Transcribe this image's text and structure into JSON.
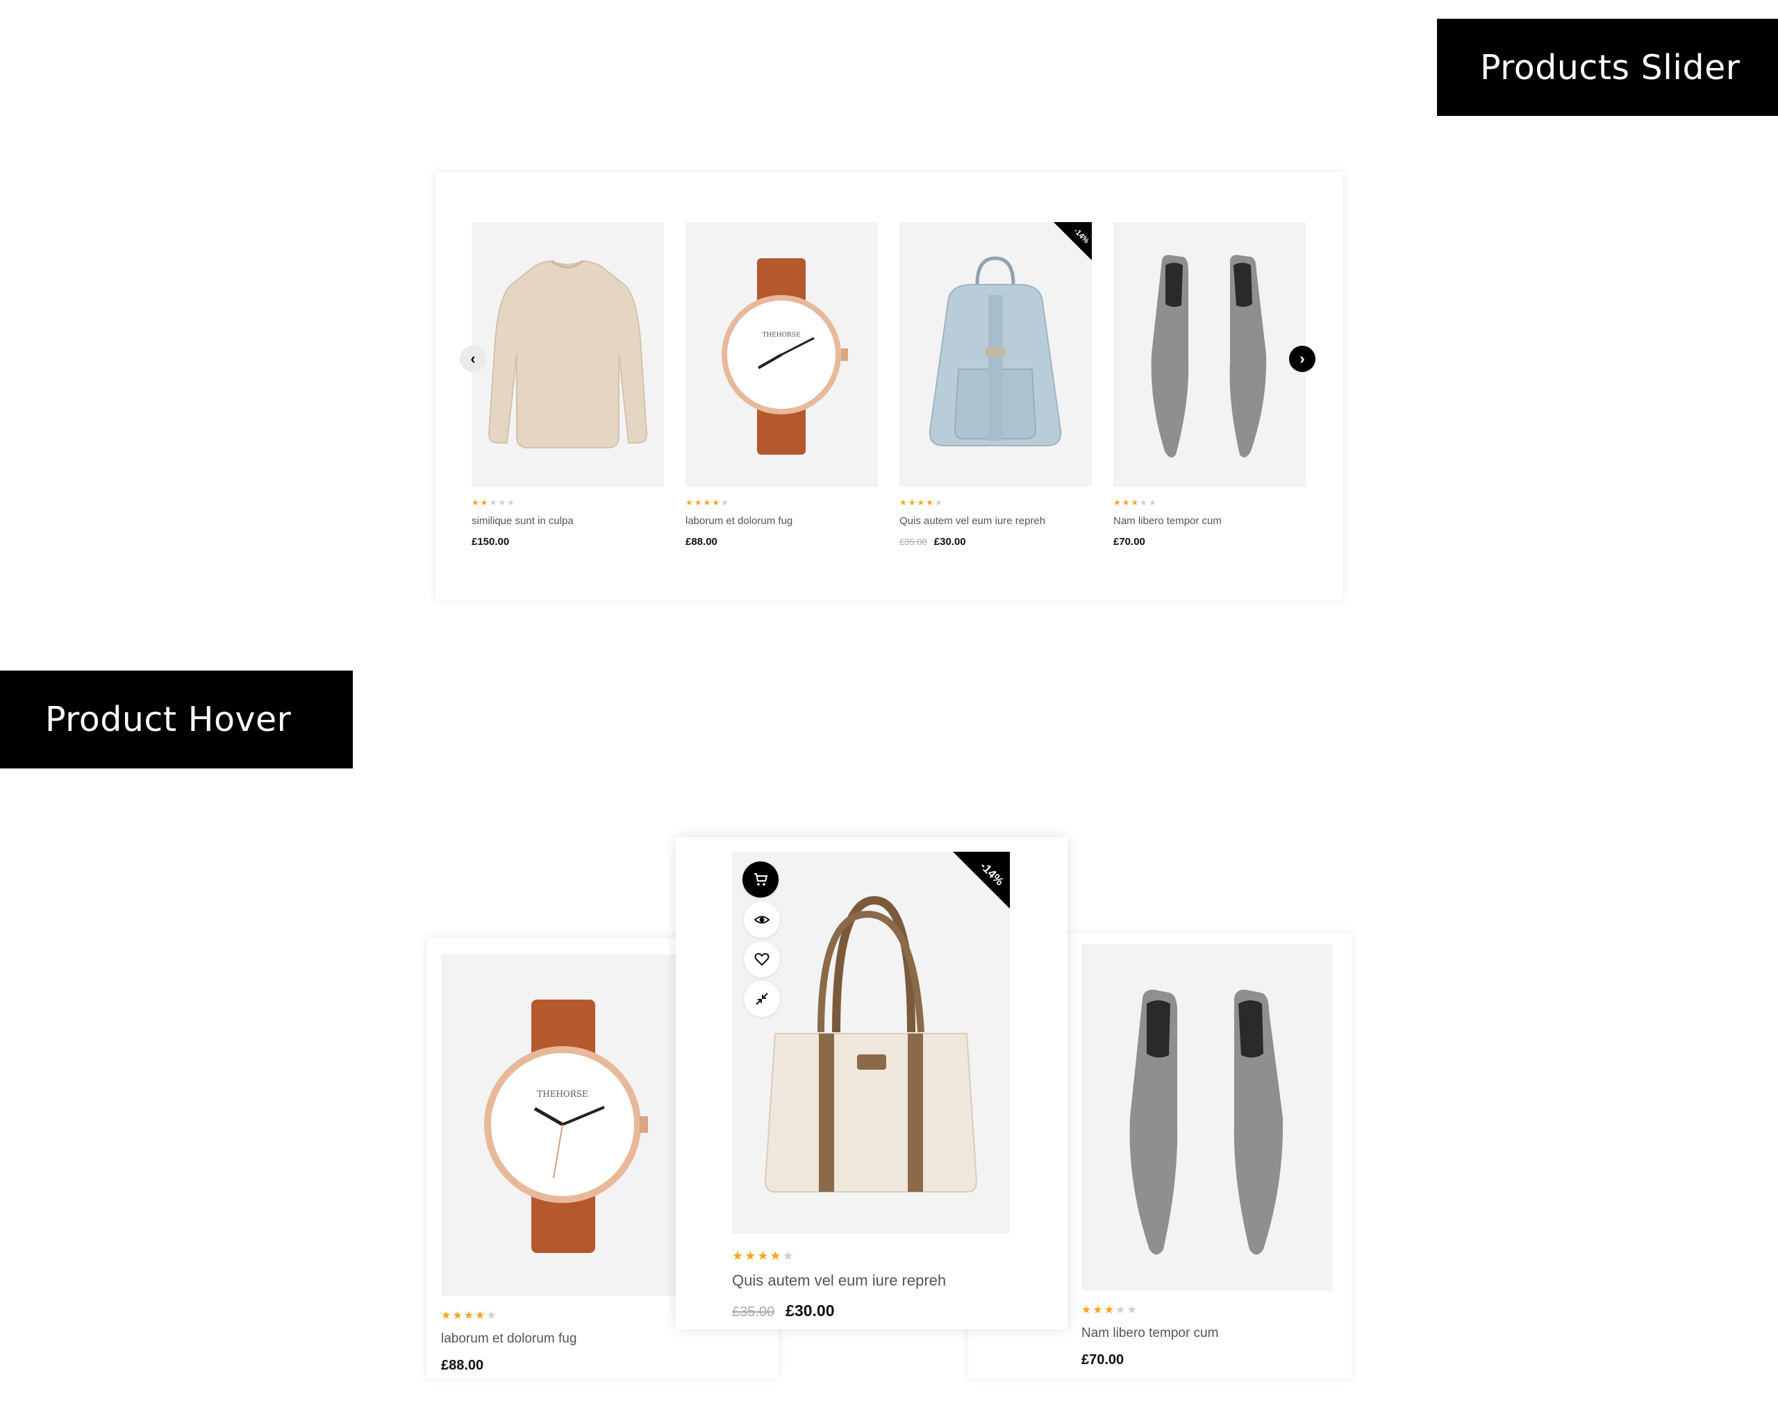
{
  "tags": {
    "slider": "Products Slider",
    "hover": "Product Hover"
  },
  "slider": {
    "prev_icon": "chevron-left-icon",
    "next_icon": "chevron-right-icon",
    "prev_glyph": "‹",
    "next_glyph": "›",
    "products": [
      {
        "title": "similique sunt in culpa",
        "price": "£150.00",
        "old_price": "",
        "rating": 2,
        "image": "sweater"
      },
      {
        "title": "laborum et dolorum fug",
        "price": "£88.00",
        "old_price": "",
        "rating": 4,
        "image": "watch"
      },
      {
        "title": "Quis autem vel eum iure repreh",
        "price": "£30.00",
        "old_price": "£35.00",
        "rating": 4,
        "image": "backpack",
        "badge": "-14%"
      },
      {
        "title": "Nam libero tempor cum",
        "price": "£70.00",
        "old_price": "",
        "rating": 3,
        "image": "boots"
      }
    ]
  },
  "hover": {
    "left": {
      "title": "laborum et dolorum fug",
      "price": "£88.00",
      "rating": 4,
      "image": "watch"
    },
    "middle": {
      "title": "Quis autem vel eum iure repreh",
      "price": "£30.00",
      "old_price": "£35.00",
      "rating": 4,
      "image": "tote-bag",
      "badge": "-14%",
      "actions": [
        "cart-icon",
        "eye-icon",
        "heart-icon",
        "compare-icon"
      ]
    },
    "right": {
      "title": "Nam libero tempor cum",
      "price": "£70.00",
      "rating": 3,
      "image": "boots"
    }
  },
  "colors": {
    "star_on": "#f5a623",
    "star_off": "#cfcfcf",
    "image_bg": "#f3f3f3"
  }
}
